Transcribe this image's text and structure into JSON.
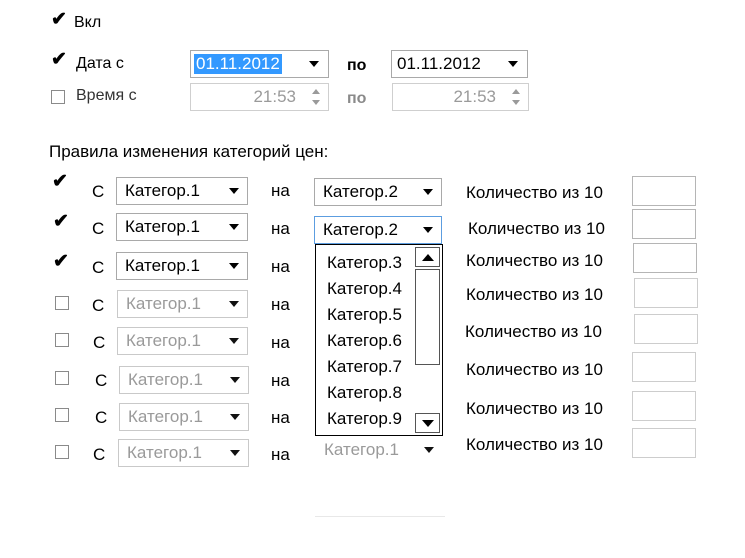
{
  "top": {
    "enabled": {
      "label": "Вкл",
      "checked": true
    },
    "date": {
      "label": "Дата с",
      "checked": true,
      "from": "01.11.2012",
      "to_label": "по",
      "to": "01.11.2012"
    },
    "time": {
      "label": "Время с",
      "checked": false,
      "from": "21:53",
      "to_label": "по",
      "to": "21:53"
    }
  },
  "rules": {
    "title": "Правила изменения категорий цен:",
    "from_label": "С",
    "to_label": "на",
    "quantity_label": "Количество из 10",
    "rows": [
      {
        "checked": true,
        "from": "Категор.1",
        "to": "Категор.2",
        "quantity": ""
      },
      {
        "checked": true,
        "from": "Категор.1",
        "to": "Категор.2",
        "quantity": ""
      },
      {
        "checked": true,
        "from": "Категор.1",
        "to": "",
        "quantity": ""
      },
      {
        "checked": false,
        "from": "Категор.1",
        "to": "",
        "quantity": ""
      },
      {
        "checked": false,
        "from": "Категор.1",
        "to": "",
        "quantity": ""
      },
      {
        "checked": false,
        "from": "Категор.1",
        "to": "",
        "quantity": ""
      },
      {
        "checked": false,
        "from": "Категор.1",
        "to": "",
        "quantity": ""
      },
      {
        "checked": false,
        "from": "Категор.1",
        "to": "Категор.1",
        "quantity": ""
      }
    ]
  },
  "dropdown_list": {
    "items": [
      "Категор.3",
      "Категор.4",
      "Категор.5",
      "Категор.6",
      "Категор.7",
      "Категор.8",
      "Категор.9"
    ]
  },
  "icons": {
    "check": "check-icon",
    "arrow_down": "chevron-down-icon",
    "arrow_up": "chevron-up-icon",
    "spin": "spin-updown-icon"
  }
}
